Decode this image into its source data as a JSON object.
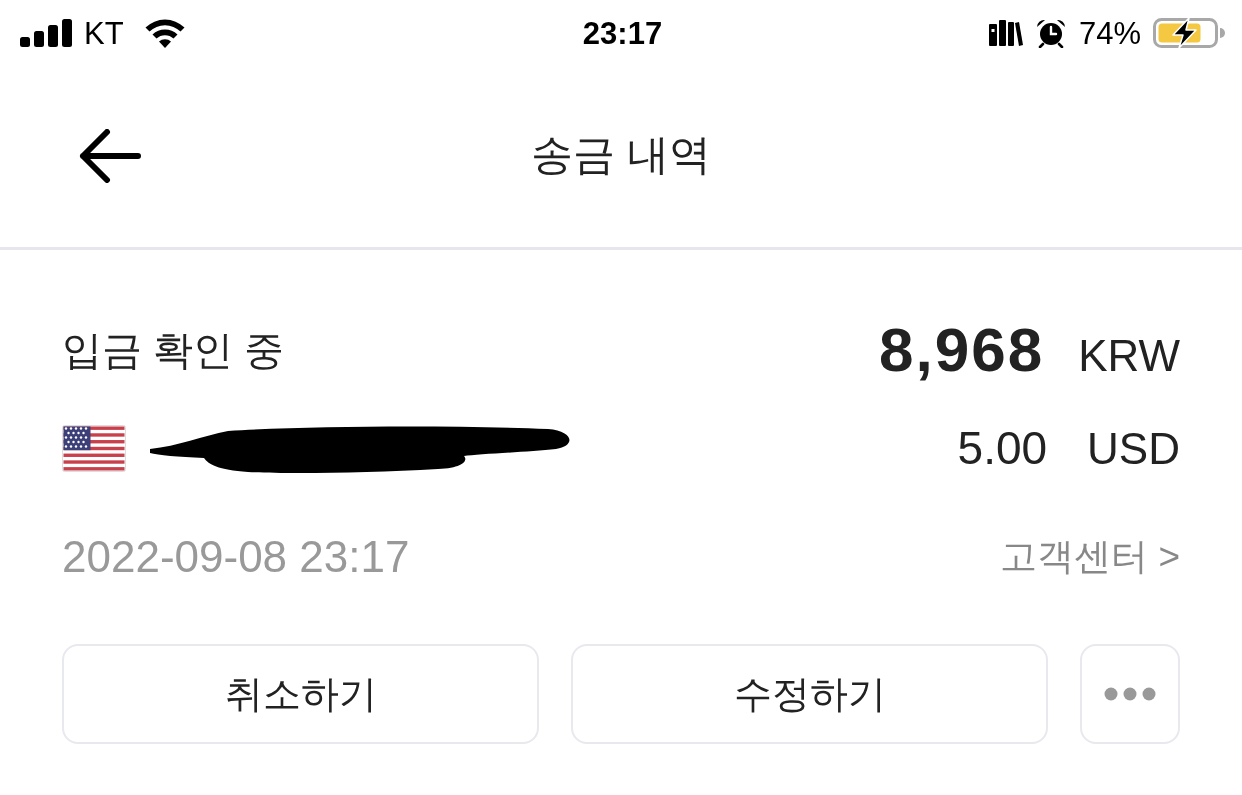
{
  "status_bar": {
    "carrier": "KT",
    "time": "23:17",
    "battery_percent": "74%",
    "charging": true
  },
  "header": {
    "title": "송금 내역"
  },
  "transfer": {
    "status": "입금 확인 중",
    "amount": "8,968",
    "amount_currency": "KRW",
    "converted_amount": "5.00",
    "converted_currency": "USD",
    "date": "2022-09-08 23:17",
    "support_link": "고객센터 >"
  },
  "actions": [
    {
      "kind": "text",
      "label": "취소하기"
    },
    {
      "kind": "text",
      "label": "수정하기"
    },
    {
      "kind": "more"
    }
  ]
}
